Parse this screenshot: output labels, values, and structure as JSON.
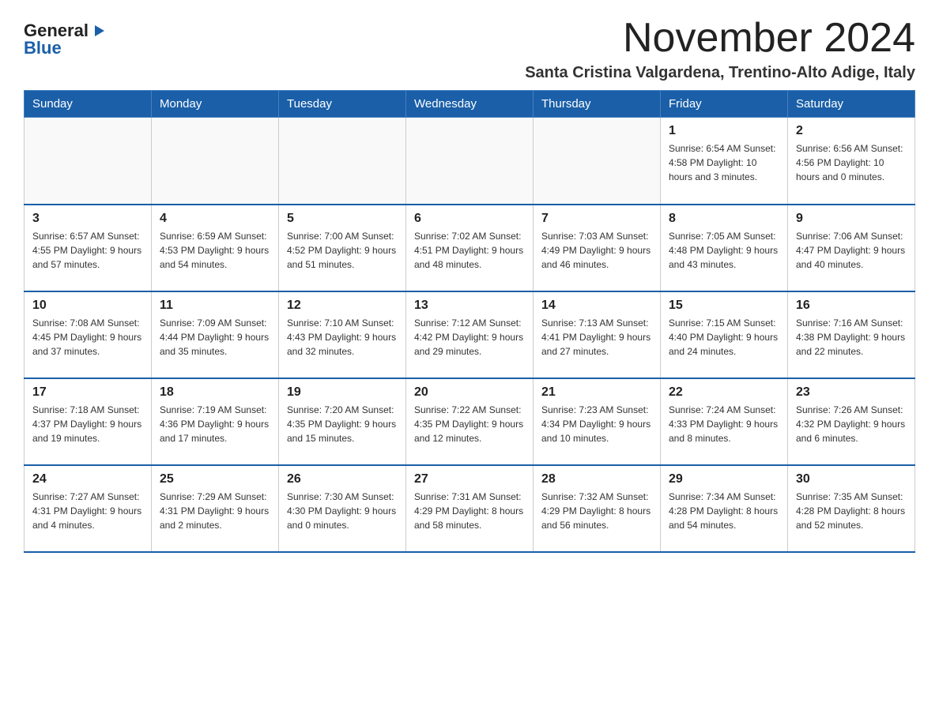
{
  "logo": {
    "general": "General",
    "blue": "Blue"
  },
  "header": {
    "month_year": "November 2024",
    "location": "Santa Cristina Valgardena, Trentino-Alto Adige, Italy"
  },
  "weekdays": [
    "Sunday",
    "Monday",
    "Tuesday",
    "Wednesday",
    "Thursday",
    "Friday",
    "Saturday"
  ],
  "weeks": [
    [
      {
        "day": "",
        "info": ""
      },
      {
        "day": "",
        "info": ""
      },
      {
        "day": "",
        "info": ""
      },
      {
        "day": "",
        "info": ""
      },
      {
        "day": "",
        "info": ""
      },
      {
        "day": "1",
        "info": "Sunrise: 6:54 AM\nSunset: 4:58 PM\nDaylight: 10 hours\nand 3 minutes."
      },
      {
        "day": "2",
        "info": "Sunrise: 6:56 AM\nSunset: 4:56 PM\nDaylight: 10 hours\nand 0 minutes."
      }
    ],
    [
      {
        "day": "3",
        "info": "Sunrise: 6:57 AM\nSunset: 4:55 PM\nDaylight: 9 hours\nand 57 minutes."
      },
      {
        "day": "4",
        "info": "Sunrise: 6:59 AM\nSunset: 4:53 PM\nDaylight: 9 hours\nand 54 minutes."
      },
      {
        "day": "5",
        "info": "Sunrise: 7:00 AM\nSunset: 4:52 PM\nDaylight: 9 hours\nand 51 minutes."
      },
      {
        "day": "6",
        "info": "Sunrise: 7:02 AM\nSunset: 4:51 PM\nDaylight: 9 hours\nand 48 minutes."
      },
      {
        "day": "7",
        "info": "Sunrise: 7:03 AM\nSunset: 4:49 PM\nDaylight: 9 hours\nand 46 minutes."
      },
      {
        "day": "8",
        "info": "Sunrise: 7:05 AM\nSunset: 4:48 PM\nDaylight: 9 hours\nand 43 minutes."
      },
      {
        "day": "9",
        "info": "Sunrise: 7:06 AM\nSunset: 4:47 PM\nDaylight: 9 hours\nand 40 minutes."
      }
    ],
    [
      {
        "day": "10",
        "info": "Sunrise: 7:08 AM\nSunset: 4:45 PM\nDaylight: 9 hours\nand 37 minutes."
      },
      {
        "day": "11",
        "info": "Sunrise: 7:09 AM\nSunset: 4:44 PM\nDaylight: 9 hours\nand 35 minutes."
      },
      {
        "day": "12",
        "info": "Sunrise: 7:10 AM\nSunset: 4:43 PM\nDaylight: 9 hours\nand 32 minutes."
      },
      {
        "day": "13",
        "info": "Sunrise: 7:12 AM\nSunset: 4:42 PM\nDaylight: 9 hours\nand 29 minutes."
      },
      {
        "day": "14",
        "info": "Sunrise: 7:13 AM\nSunset: 4:41 PM\nDaylight: 9 hours\nand 27 minutes."
      },
      {
        "day": "15",
        "info": "Sunrise: 7:15 AM\nSunset: 4:40 PM\nDaylight: 9 hours\nand 24 minutes."
      },
      {
        "day": "16",
        "info": "Sunrise: 7:16 AM\nSunset: 4:38 PM\nDaylight: 9 hours\nand 22 minutes."
      }
    ],
    [
      {
        "day": "17",
        "info": "Sunrise: 7:18 AM\nSunset: 4:37 PM\nDaylight: 9 hours\nand 19 minutes."
      },
      {
        "day": "18",
        "info": "Sunrise: 7:19 AM\nSunset: 4:36 PM\nDaylight: 9 hours\nand 17 minutes."
      },
      {
        "day": "19",
        "info": "Sunrise: 7:20 AM\nSunset: 4:35 PM\nDaylight: 9 hours\nand 15 minutes."
      },
      {
        "day": "20",
        "info": "Sunrise: 7:22 AM\nSunset: 4:35 PM\nDaylight: 9 hours\nand 12 minutes."
      },
      {
        "day": "21",
        "info": "Sunrise: 7:23 AM\nSunset: 4:34 PM\nDaylight: 9 hours\nand 10 minutes."
      },
      {
        "day": "22",
        "info": "Sunrise: 7:24 AM\nSunset: 4:33 PM\nDaylight: 9 hours\nand 8 minutes."
      },
      {
        "day": "23",
        "info": "Sunrise: 7:26 AM\nSunset: 4:32 PM\nDaylight: 9 hours\nand 6 minutes."
      }
    ],
    [
      {
        "day": "24",
        "info": "Sunrise: 7:27 AM\nSunset: 4:31 PM\nDaylight: 9 hours\nand 4 minutes."
      },
      {
        "day": "25",
        "info": "Sunrise: 7:29 AM\nSunset: 4:31 PM\nDaylight: 9 hours\nand 2 minutes."
      },
      {
        "day": "26",
        "info": "Sunrise: 7:30 AM\nSunset: 4:30 PM\nDaylight: 9 hours\nand 0 minutes."
      },
      {
        "day": "27",
        "info": "Sunrise: 7:31 AM\nSunset: 4:29 PM\nDaylight: 8 hours\nand 58 minutes."
      },
      {
        "day": "28",
        "info": "Sunrise: 7:32 AM\nSunset: 4:29 PM\nDaylight: 8 hours\nand 56 minutes."
      },
      {
        "day": "29",
        "info": "Sunrise: 7:34 AM\nSunset: 4:28 PM\nDaylight: 8 hours\nand 54 minutes."
      },
      {
        "day": "30",
        "info": "Sunrise: 7:35 AM\nSunset: 4:28 PM\nDaylight: 8 hours\nand 52 minutes."
      }
    ]
  ]
}
